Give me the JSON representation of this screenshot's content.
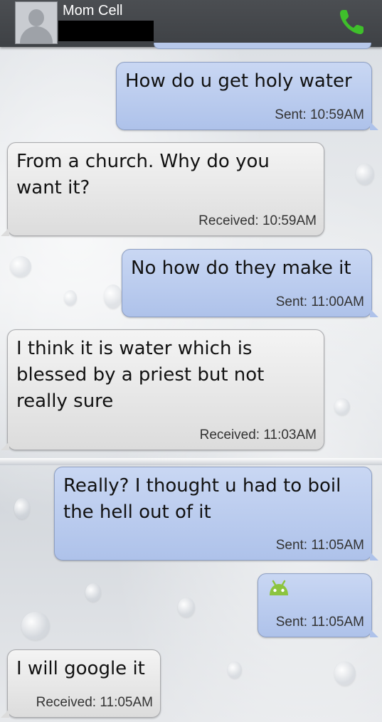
{
  "header": {
    "contact_name": "Mom Cell",
    "call_icon": "phone-icon",
    "call_color": "#3fbf2b"
  },
  "messages": [
    {
      "direction": "sent",
      "text": "How do u get holy water",
      "stamp": "Sent: 10:59AM"
    },
    {
      "direction": "received",
      "text": "From a church. Why do you want it?",
      "stamp": "Received: 10:59AM"
    },
    {
      "direction": "sent",
      "text": "No how do they make it",
      "stamp": "Sent: 11:00AM"
    },
    {
      "direction": "received",
      "text": "I think it is water which is blessed by a priest but not really sure",
      "stamp": "Received: 11:03AM"
    },
    {
      "direction": "sent",
      "text": "Really? I thought u had to boil the hell out of it",
      "stamp": "Sent: 11:05AM"
    },
    {
      "direction": "sent",
      "text": "",
      "icon": "android-emoticon-icon",
      "stamp": "Sent: 11:05AM"
    },
    {
      "direction": "received",
      "text": "I will google it",
      "stamp": "Received: 11:05AM"
    }
  ],
  "colors": {
    "sent_bubble": "#b8cbef",
    "received_bubble": "#e8e8e8",
    "header_bg": "#45484c"
  }
}
